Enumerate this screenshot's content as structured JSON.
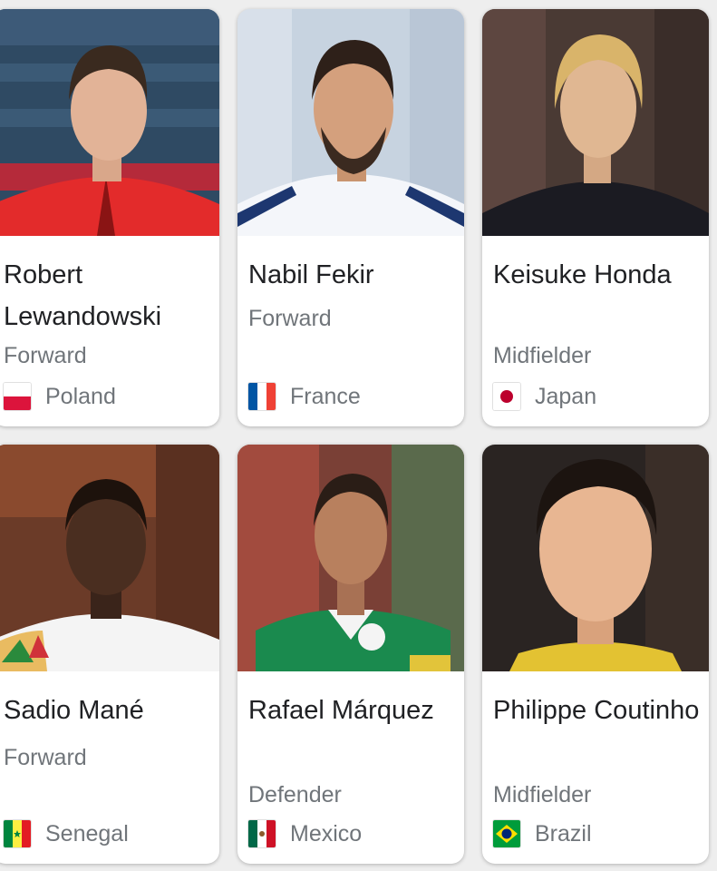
{
  "players": [
    {
      "name": "Robert Lewandowski",
      "position": "Forward",
      "country": "Poland",
      "flag_icon": "poland-flag-icon"
    },
    {
      "name": "Nabil Fekir",
      "position": "Forward",
      "country": "France",
      "flag_icon": "france-flag-icon"
    },
    {
      "name": "Keisuke Honda",
      "position": "Midfielder",
      "country": "Japan",
      "flag_icon": "japan-flag-icon"
    },
    {
      "name": "Sadio Mané",
      "position": "Forward",
      "country": "Senegal",
      "flag_icon": "senegal-flag-icon"
    },
    {
      "name": "Rafael Márquez",
      "position": "Defender",
      "country": "Mexico",
      "flag_icon": "mexico-flag-icon"
    },
    {
      "name": "Philippe Coutinho",
      "position": "Midfielder",
      "country": "Brazil",
      "flag_icon": "brazil-flag-icon"
    }
  ],
  "colors": {
    "card_bg": "#ffffff",
    "name_text": "#202124",
    "secondary_text": "#70757a",
    "page_bg": "#eeeeee"
  }
}
